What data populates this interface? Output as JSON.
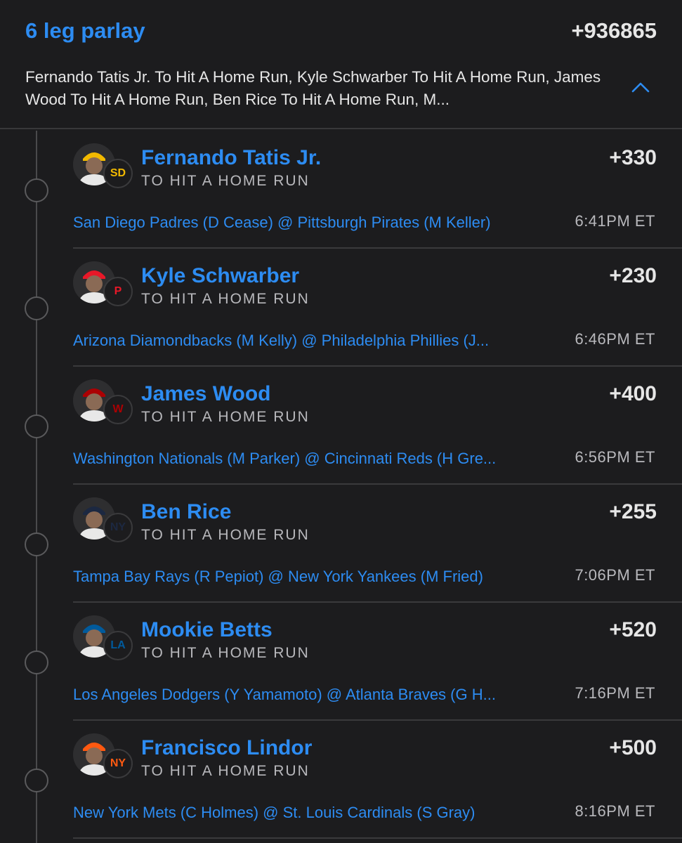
{
  "parlay": {
    "title": "6 leg parlay",
    "odds": "+936865",
    "summary": "Fernando Tatis Jr. To Hit A Home Run, Kyle Schwarber To Hit A Home Run, James Wood To Hit A Home Run, Ben Rice To Hit A Home Run, M..."
  },
  "colors": {
    "accent": "#2d8cf2",
    "background": "#1c1c1e"
  },
  "legs": [
    {
      "player": "Fernando Tatis Jr.",
      "market": "TO HIT A HOME RUN",
      "odds": "+330",
      "matchup": "San Diego Padres (D Cease) @ Pittsburgh Pirates (M Keller)",
      "time": "6:41PM ET",
      "team_icon": "padres-logo-icon",
      "badge_text": "SD",
      "badge_color": "#f2b900"
    },
    {
      "player": "Kyle Schwarber",
      "market": "TO HIT A HOME RUN",
      "odds": "+230",
      "matchup": "Arizona Diamondbacks (M Kelly) @ Philadelphia Phillies (J...",
      "time": "6:46PM ET",
      "team_icon": "phillies-logo-icon",
      "badge_text": "P",
      "badge_color": "#e81828"
    },
    {
      "player": "James Wood",
      "market": "TO HIT A HOME RUN",
      "odds": "+400",
      "matchup": "Washington Nationals (M Parker) @ Cincinnati Reds (H Gre...",
      "time": "6:56PM ET",
      "team_icon": "nationals-logo-icon",
      "badge_text": "W",
      "badge_color": "#ab0003"
    },
    {
      "player": "Ben Rice",
      "market": "TO HIT A HOME RUN",
      "odds": "+255",
      "matchup": "Tampa Bay Rays (R Pepiot) @ New York Yankees (M Fried)",
      "time": "7:06PM ET",
      "team_icon": "yankees-logo-icon",
      "badge_text": "NY",
      "badge_color": "#1c2841"
    },
    {
      "player": "Mookie Betts",
      "market": "TO HIT A HOME RUN",
      "odds": "+520",
      "matchup": "Los Angeles Dodgers (Y Yamamoto) @ Atlanta Braves (G H...",
      "time": "7:16PM ET",
      "team_icon": "dodgers-logo-icon",
      "badge_text": "LA",
      "badge_color": "#005a9c"
    },
    {
      "player": "Francisco Lindor",
      "market": "TO HIT A HOME RUN",
      "odds": "+500",
      "matchup": "New York Mets (C Holmes) @ St. Louis Cardinals (S Gray)",
      "time": "8:16PM ET",
      "team_icon": "mets-logo-icon",
      "badge_text": "NY",
      "badge_color": "#ff5910"
    }
  ]
}
